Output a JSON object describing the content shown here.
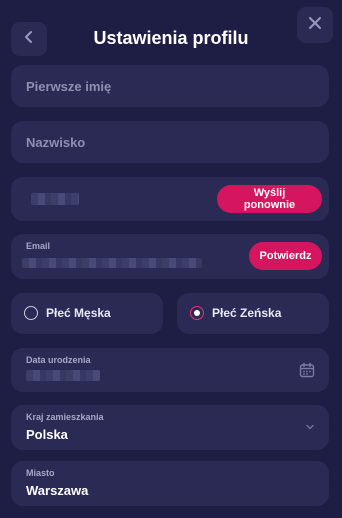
{
  "header": {
    "title": "Ustawienia profilu",
    "back_icon": "chevron-left-icon",
    "close_icon": "close-icon"
  },
  "form": {
    "first_name_placeholder": "Pierwsze imię",
    "last_name_placeholder": "Nazwisko",
    "phone_resend_label": "Wyślij ponownie",
    "email_label": "Email",
    "email_confirm_label": "Potwierdz",
    "gender_male_label": "Płeć Męska",
    "gender_female_label": "Płeć Zeńska",
    "gender_selected": "Płeć Zeńska",
    "birthdate_label": "Data urodzenia",
    "calendar_icon": "calendar-icon",
    "country_label": "Kraj zamieszkania",
    "country_value": "Polska",
    "dropdown_icon": "chevron-down-icon",
    "city_label": "Miasto",
    "city_value": "Warszawa"
  },
  "colors": {
    "background": "#1e1e44",
    "field_bg": "#2a2a55",
    "accent": "#d6155f",
    "placeholder_text": "#8f8fb3"
  }
}
